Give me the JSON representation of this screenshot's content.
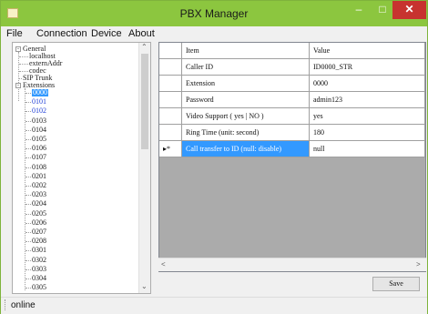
{
  "window": {
    "title": "PBX Manager"
  },
  "menu": [
    "File",
    "Connection",
    "Device",
    "About"
  ],
  "tree": {
    "general": {
      "label": "General",
      "children": [
        "localhost",
        "externAddr",
        "codec"
      ]
    },
    "sip_trunk": "SIP Trunk",
    "extensions": {
      "label": "Extensions",
      "items": [
        "0000",
        "0101",
        "0102",
        "0103",
        "0104",
        "0105",
        "0106",
        "0107",
        "0108",
        "0201",
        "0202",
        "0203",
        "0204",
        "0205",
        "0206",
        "0207",
        "0208",
        "0301",
        "0302",
        "0303",
        "0304",
        "0305"
      ],
      "selected": "0000",
      "highlighted": [
        "0101",
        "0102"
      ]
    }
  },
  "grid": {
    "headers": [
      "Item",
      "Value"
    ],
    "rows": [
      {
        "item": "Caller ID",
        "value": "ID0000_STR"
      },
      {
        "item": "Extension",
        "value": "0000"
      },
      {
        "item": "Password",
        "value": "admin123"
      },
      {
        "item": "Video Support ( yes | NO )",
        "value": "yes"
      },
      {
        "item": "Ring Time (unit: second)",
        "value": "180"
      },
      {
        "item": "Call transfer to ID (null: disable)",
        "value": "null",
        "selected": true,
        "marker": "▸*"
      }
    ]
  },
  "save_label": "Save",
  "status": "online",
  "colors": {
    "titlebar": "#8cc63f",
    "close": "#c7332f",
    "selection": "#3399ff"
  }
}
